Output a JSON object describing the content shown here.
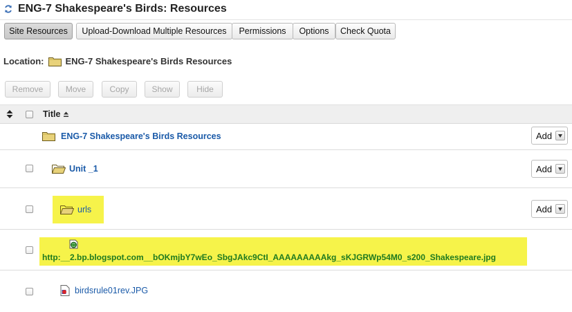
{
  "page": {
    "title": "ENG-7 Shakespeare's Birds: Resources"
  },
  "tabs": [
    {
      "label": "Site Resources",
      "active": true
    },
    {
      "label": "Upload-Download Multiple Resources",
      "active": false
    },
    {
      "label": "Permissions",
      "active": false
    },
    {
      "label": "Options",
      "active": false
    },
    {
      "label": "Check Quota",
      "active": false
    }
  ],
  "location": {
    "label": "Location:",
    "path": "ENG-7 Shakespeare's Birds Resources"
  },
  "actions": [
    "Remove",
    "Move",
    "Copy",
    "Show",
    "Hide"
  ],
  "table": {
    "title_header": "Title"
  },
  "rows": [
    {
      "name": "ENG-7 Shakespeare's Birds Resources",
      "type": "folder-closed",
      "add_label": "Add"
    },
    {
      "name": "Unit _1",
      "type": "folder-open",
      "add_label": "Add"
    },
    {
      "name": "urls",
      "type": "folder-open",
      "add_label": "Add",
      "highlighted": true
    },
    {
      "name": "http:__2.bp.blogspot.com__bOKmjbY7wEo_SbgJAkc9CtI_AAAAAAAAAkg_sKJGRWp54M0_s200_Shakespeare.jpg",
      "type": "url",
      "highlighted": true
    },
    {
      "name": "birdsrule01rev.JPG",
      "type": "image-file"
    }
  ],
  "colors": {
    "link": "#1a5aa8",
    "highlight": "#f6f34a",
    "url_text": "#1f7a1f",
    "folder": "#e8d27a"
  }
}
